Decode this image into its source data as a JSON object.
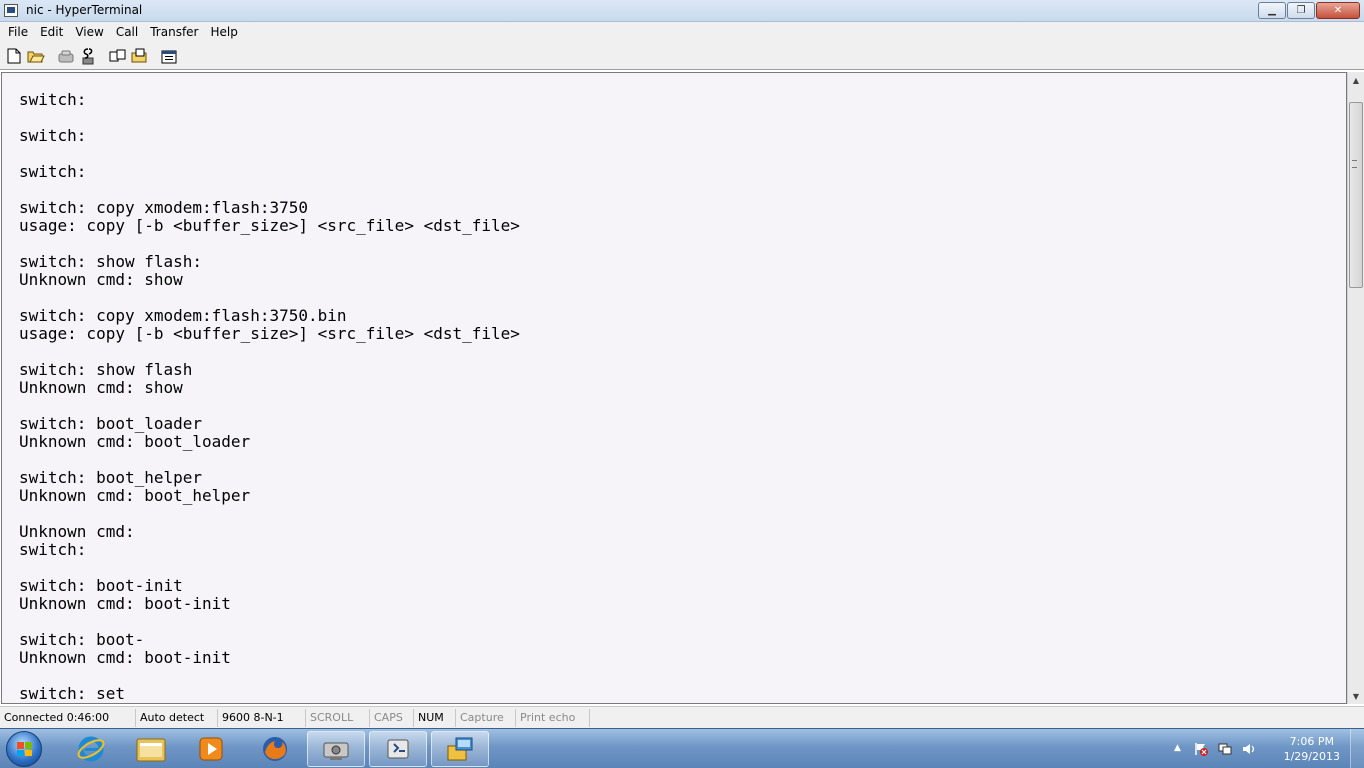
{
  "window": {
    "title": "nic - HyperTerminal",
    "minimize_glyph": "▁",
    "maximize_glyph": "❐",
    "close_glyph": "✕"
  },
  "menu": [
    "File",
    "Edit",
    "View",
    "Call",
    "Transfer",
    "Help"
  ],
  "toolbar": {
    "icons": [
      "new-file-icon",
      "open-folder-icon",
      "call-icon",
      "disconnect-icon",
      "send-file-icon",
      "receive-file-icon",
      "properties-icon"
    ]
  },
  "terminal": {
    "lines": [
      "switch:",
      "",
      "switch:",
      "",
      "switch:",
      "",
      "switch: copy xmodem:flash:3750",
      "usage: copy [-b <buffer_size>] <src_file> <dst_file>",
      "",
      "switch: show flash:",
      "Unknown cmd: show",
      "",
      "switch: copy xmodem:flash:3750.bin",
      "usage: copy [-b <buffer_size>] <src_file> <dst_file>",
      "",
      "switch: show flash",
      "Unknown cmd: show",
      "",
      "switch: boot_loader",
      "Unknown cmd: boot_loader",
      "",
      "switch: boot_helper",
      "Unknown cmd: boot_helper",
      "",
      "Unknown cmd:",
      "switch:",
      "",
      "switch: boot-init",
      "Unknown cmd: boot-init",
      "",
      "switch: boot-",
      "Unknown cmd: boot-init",
      "",
      "switch: set"
    ]
  },
  "scrollbar": {
    "up_glyph": "▲",
    "down_glyph": "▼"
  },
  "status": {
    "connected": "Connected 0:46:00",
    "detect": "Auto detect",
    "settings": "9600 8-N-1",
    "scroll": "SCROLL",
    "caps": "CAPS",
    "num": "NUM",
    "capture": "Capture",
    "print_echo": "Print echo"
  },
  "taskbar": {
    "apps": [
      "internet-explorer-icon",
      "windows-explorer-icon",
      "media-player-icon",
      "firefox-icon",
      "network-app-icon",
      "hyperterminal-icon",
      "tftp-app-icon"
    ],
    "tray_arrow": "▲",
    "clock_time": "7:06 PM",
    "clock_date": "1/29/2013"
  }
}
